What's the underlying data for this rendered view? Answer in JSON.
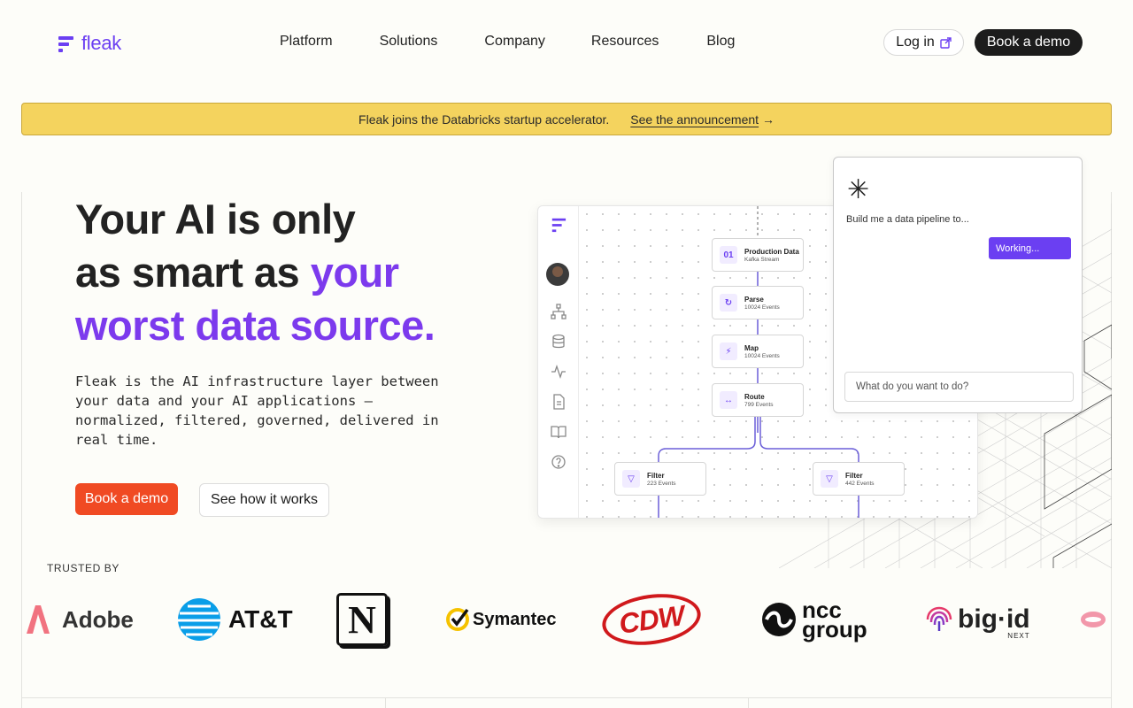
{
  "brand": {
    "name": "fleak",
    "color": "#6b3ff2"
  },
  "nav": {
    "links": [
      "Platform",
      "Solutions",
      "Company",
      "Resources",
      "Blog"
    ],
    "login_label": "Log in",
    "demo_label": "Book a demo"
  },
  "banner": {
    "text": "Fleak joins the Databricks startup accelerator.",
    "link_label": "See the announcement",
    "arrow": "→",
    "color": "#f4d35e"
  },
  "hero": {
    "line1": "Your AI is only",
    "line2_plain": "as smart as ",
    "line2_accent": "your",
    "line3_accent": "worst data source.",
    "accent_color": "#7c3aed",
    "subtitle": "Fleak is the AI infrastructure layer between your data and your AI applications — normalized, filtered, governed, delivered in real time.",
    "primary_cta": "Book a demo",
    "secondary_cta": "See how it works",
    "primary_color": "#f04a23"
  },
  "pipeline": {
    "nodes": [
      {
        "title": "Production Data",
        "subtitle": "Kafka Stream",
        "icon": "database-icon"
      },
      {
        "title": "Parse",
        "subtitle": "10024 Events",
        "icon": "refresh-icon"
      },
      {
        "title": "Map",
        "subtitle": "10024 Events",
        "icon": "bolt-icon"
      },
      {
        "title": "Route",
        "subtitle": "799 Events",
        "icon": "arrows-icon"
      },
      {
        "title": "Filter",
        "subtitle": "223 Events",
        "icon": "filter-icon"
      },
      {
        "title": "Filter",
        "subtitle": "442 Events",
        "icon": "filter-icon"
      }
    ]
  },
  "chat": {
    "prompt": "Build me a data pipeline to...",
    "status": "Working...",
    "input_placeholder": "What do you want to do?"
  },
  "trusted": {
    "label": "TRUSTED BY",
    "logos": [
      "Adobe",
      "AT&T",
      "N",
      "Symantec",
      "CDW",
      "ncc",
      "group",
      "big·id",
      "NEXT"
    ]
  }
}
